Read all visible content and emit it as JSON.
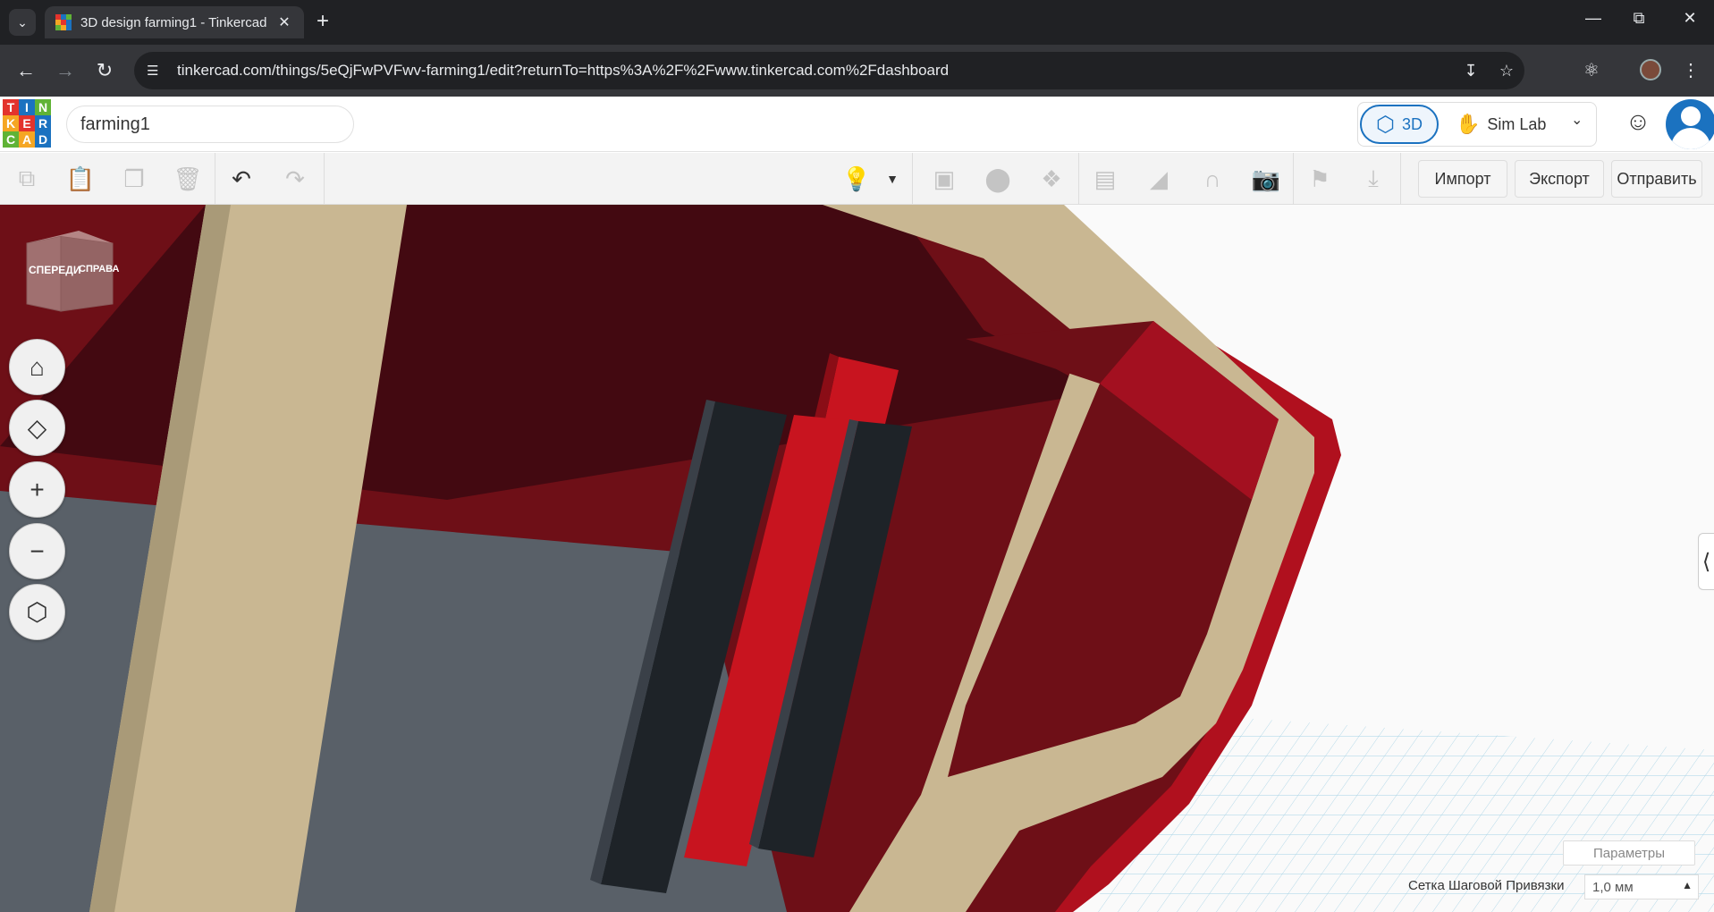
{
  "browser": {
    "tab_title": "3D design farming1 - Tinkercad",
    "url": "tinkercad.com/things/5eQjFwPVFwv-farming1/edit?returnTo=https%3A%2F%2Fwww.tinkercad.com%2Fdashboard",
    "icons": {
      "tab_list": "chevron-down-icon",
      "close_tab": "close-icon",
      "new_tab": "plus-icon",
      "minimize": "minimize-icon",
      "restore": "restore-icon",
      "close_window": "close-icon",
      "back": "back-arrow-icon",
      "forward": "forward-arrow-icon",
      "reload": "reload-icon",
      "site_info": "tune-icon",
      "install": "install-icon",
      "bookmark": "star-icon",
      "extensions": "puzzle-icon",
      "menu": "kebab-icon"
    }
  },
  "header": {
    "logo_letters": [
      "T",
      "I",
      "N",
      "K",
      "E",
      "R",
      "C",
      "A",
      "D"
    ],
    "logo_colors": [
      "#e3332d",
      "#1b72c0",
      "#60b336",
      "#f5a623",
      "#e3332d",
      "#1b72c0",
      "#60b336",
      "#f5a623",
      "#1b72c0"
    ],
    "design_name": "farming1",
    "view_3d_label": "3D",
    "simlab_label": "Sim Lab",
    "accent_color": "#1b72c0"
  },
  "toolbar": {
    "import_label": "Импорт",
    "export_label": "Экспорт",
    "send_label": "Отправить",
    "tools": [
      "copy-icon",
      "paste-icon",
      "duplicate-icon",
      "delete-icon",
      "undo-icon",
      "redo-icon",
      "lightbulb-icon",
      "dropdown-icon",
      "group-icon",
      "union-icon",
      "ungroup-icon",
      "align-icon",
      "mirror-icon",
      "magnet-icon",
      "ruler-icon",
      "cruise-icon",
      "drop-icon"
    ]
  },
  "viewport": {
    "view_cube_front": "СПЕРЕДИ",
    "view_cube_right": "СПРАВА",
    "nav_controls": [
      "home-icon",
      "fit-view-icon",
      "zoom-in-icon",
      "zoom-out-icon",
      "perspective-icon"
    ]
  },
  "footer": {
    "params_label": "Параметры",
    "grid_snap_label": "Сетка Шаговой Привязки",
    "grid_snap_value": "1,0 мм"
  }
}
